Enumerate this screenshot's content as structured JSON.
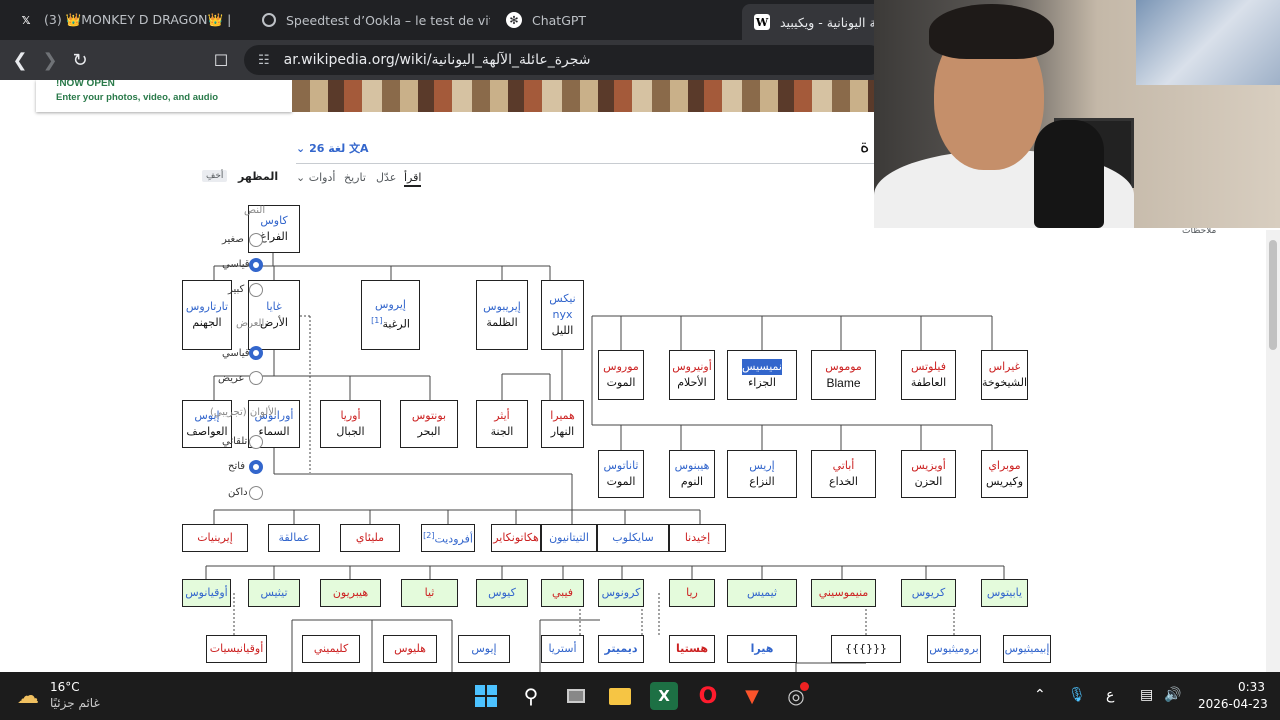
{
  "tabs": [
    {
      "label": "(3) 👑MONKEY D DRAGON👑 |",
      "favicon": "x-logo-icon",
      "active": false
    },
    {
      "label": "Speedtest d’Ookla – le test de vitesse",
      "favicon": "speedtest-icon",
      "active": false
    },
    {
      "label": "ChatGPT",
      "favicon": "chatgpt-icon",
      "active": false
    },
    {
      "label": "شجرة عائلة الآلهة اليونانية - ويكيبيد",
      "favicon": "wikipedia-icon",
      "active": true
    }
  ],
  "address": {
    "url": "ar.wikipedia.org/wiki/شجرة_عائلة_الآلهة_اليونانية"
  },
  "banner": {
    "line1": "!NOW OPEN",
    "line2": "Enter your photos, video, and audio"
  },
  "wiki": {
    "languages": "26 لغة",
    "tabs": [
      "اقرأ",
      "عدّل",
      "تاريخ",
      "أدوات"
    ],
    "appearance": "المظهر",
    "hide": "أخفِ",
    "notes": "ملاحظات",
    "title_fragment": "ة"
  },
  "appearance_options": {
    "text_heading": "النص",
    "size_options": [
      "صغير",
      "قياسي",
      "كبير"
    ],
    "width_heading": "العرض",
    "width_options": [
      "قياسي",
      "عريض"
    ],
    "color_heading": "الألوان (تجريبي)",
    "color_options": [
      "تلقائي",
      "فاتح",
      "داكن"
    ]
  },
  "tree": {
    "chaos": {
      "name": "كاوس",
      "desc": "الفراغ"
    },
    "tartarus": {
      "name": "تارتاروس",
      "desc": "الجهنم"
    },
    "gaia": {
      "name": "غايا",
      "desc": "الأرض"
    },
    "eros": {
      "name": "إيروس",
      "desc": "الرغبة",
      "ref": "[1]"
    },
    "erebus": {
      "name": "إيريبوس",
      "desc": "الظلمة"
    },
    "nyx": {
      "name": "نيكس",
      "latin": "nyx",
      "desc": "الليل"
    },
    "uranus_left": {
      "name": "إيوس",
      "desc": "العواصف"
    },
    "uranus": {
      "name": "أورانوس",
      "desc": "السماء"
    },
    "ourea": {
      "name": "أوريا",
      "desc": "الجبال"
    },
    "pontus": {
      "name": "بونتوس",
      "desc": "البحر"
    },
    "aether": {
      "name": "أيثر",
      "desc": "الجنة"
    },
    "hemera": {
      "name": "هميرا",
      "desc": "النهار"
    },
    "nyx_children_row1": [
      {
        "name": "موروس",
        "desc": "الموت"
      },
      {
        "name": "أونيروس",
        "desc": "الأحلام"
      },
      {
        "name": "نميسيس",
        "desc": "الجزاء"
      },
      {
        "name": "مومو‌س",
        "desc": "Blame"
      },
      {
        "name": "فيلوتس",
        "desc": "العاطفة"
      },
      {
        "name": "غيراس",
        "desc": "الشيخوخة"
      }
    ],
    "nyx_children_row2": [
      {
        "name": "ثاناتوس",
        "desc": "الموت"
      },
      {
        "name": "هيبنوس",
        "desc": "النوم"
      },
      {
        "name": "إريس",
        "desc": "النزاع"
      },
      {
        "name": "أباتي",
        "desc": "الخداع"
      },
      {
        "name": "أويزيس",
        "desc": "الحزن"
      },
      {
        "name": "موبراي",
        "desc": "وكيريس"
      }
    ],
    "row3": [
      {
        "name": "إيرينيات"
      },
      {
        "name": "عمالقة"
      },
      {
        "name": "مليئاي"
      },
      {
        "name": "أفروديت",
        "ref": "[2]"
      },
      {
        "name": "هكاتونكاير"
      },
      {
        "name": "التيتانيون"
      },
      {
        "name": "سايكلوب"
      },
      {
        "name": "إخيدنا"
      }
    ],
    "titans": [
      {
        "name": "أوقيانوس"
      },
      {
        "name": "تيثيس"
      },
      {
        "name": "هيبريون"
      },
      {
        "name": "ثيا"
      },
      {
        "name": "كيوس"
      },
      {
        "name": "فيبي"
      },
      {
        "name": "كرونوس"
      },
      {
        "name": "ريا"
      },
      {
        "name": "ثيميس"
      },
      {
        "name": "منيموسيني"
      },
      {
        "name": "كريوس"
      },
      {
        "name": "يابيتوس"
      }
    ],
    "row5": [
      {
        "name": "أوقيانيسيات"
      },
      {
        "name": "كليميني"
      },
      {
        "name": "هليوس"
      },
      {
        "name": "إيوس"
      },
      {
        "name": "أستريا"
      },
      {
        "name": "ديميتر"
      },
      {
        "name": "هستيا"
      },
      {
        "name": "هيرا"
      },
      {
        "name": "{{{}}}"
      },
      {
        "name": "بروميثيوس"
      },
      {
        "name": "إبيميثيوس"
      }
    ]
  },
  "taskbar": {
    "weather_temp": "16°C",
    "weather_desc": "غائم جزئيًا",
    "lang": "ع",
    "time": "0:33",
    "date": "2026-04-23"
  }
}
